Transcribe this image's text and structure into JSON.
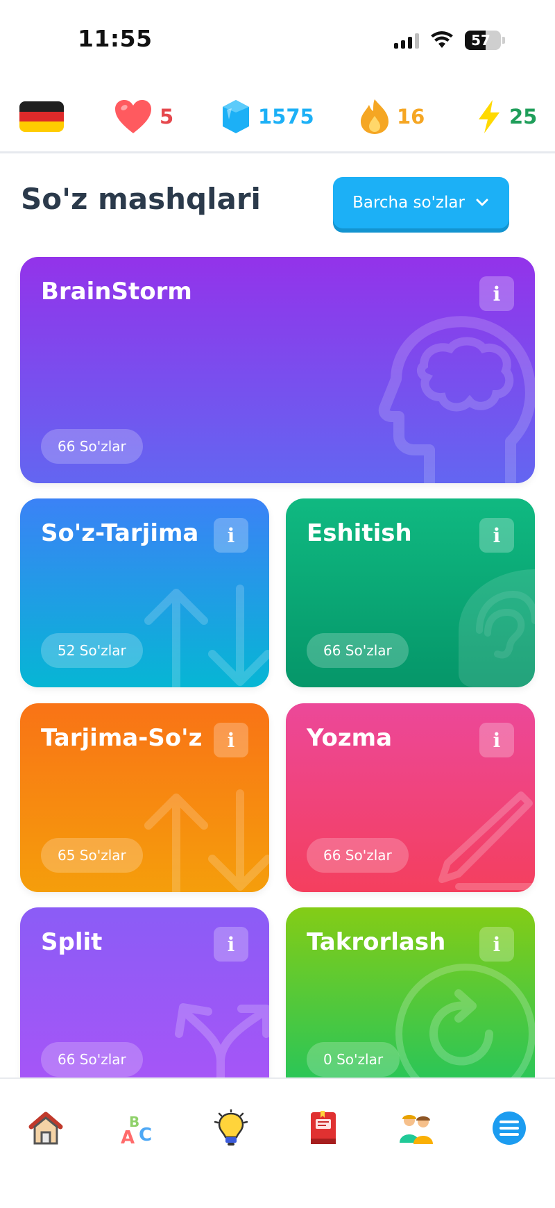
{
  "status": {
    "time": "11:55",
    "battery": "57",
    "battery_level": 0.57
  },
  "stats": {
    "language_flag": "germany-flag",
    "hearts": "5",
    "gems": "1575",
    "streak": "16",
    "xp": "25",
    "colors": {
      "hearts": "#e5484d",
      "gems": "#1cb0f6",
      "streak": "#f5a623",
      "xp": "#1f9e5a"
    }
  },
  "header": {
    "title": "So'z mashqlari",
    "filter_label": "Barcha so'zlar"
  },
  "cards": [
    {
      "title": "BrainStorm",
      "badge": "66 So'zlar",
      "icon": "brain-head-icon",
      "colors": [
        "#9333ea",
        "#6366f1"
      ]
    },
    {
      "title": "So'z-Tarjima",
      "badge": "52 So'zlar",
      "icon": "swap-arrows-icon",
      "colors": [
        "#3b82f6",
        "#06b6d4"
      ]
    },
    {
      "title": "Eshitish",
      "badge": "66 So'zlar",
      "icon": "ear-icon",
      "colors": [
        "#10b981",
        "#059669"
      ]
    },
    {
      "title": "Tarjima-So'z",
      "badge": "65 So'zlar",
      "icon": "swap-arrows-icon",
      "colors": [
        "#f97316",
        "#f59e0b"
      ]
    },
    {
      "title": "Yozma",
      "badge": "66 So'zlar",
      "icon": "pencil-icon",
      "colors": [
        "#ec4899",
        "#f43f5e"
      ]
    },
    {
      "title": "Split",
      "badge": "66 So'zlar",
      "icon": "split-arrows-icon",
      "colors": [
        "#8b5cf6",
        "#a855f7"
      ]
    },
    {
      "title": "Takrorlash",
      "badge": "0 So'zlar",
      "icon": "repeat-icon",
      "colors": [
        "#84cc16",
        "#22c55e"
      ]
    }
  ],
  "info_label": "i",
  "tabs": [
    {
      "name": "home",
      "icon": "home-icon"
    },
    {
      "name": "alphabet",
      "icon": "abc-icon"
    },
    {
      "name": "ideas",
      "icon": "lightbulb-icon"
    },
    {
      "name": "dictionary",
      "icon": "book-icon"
    },
    {
      "name": "community",
      "icon": "people-icon"
    },
    {
      "name": "menu",
      "icon": "menu-icon"
    }
  ]
}
